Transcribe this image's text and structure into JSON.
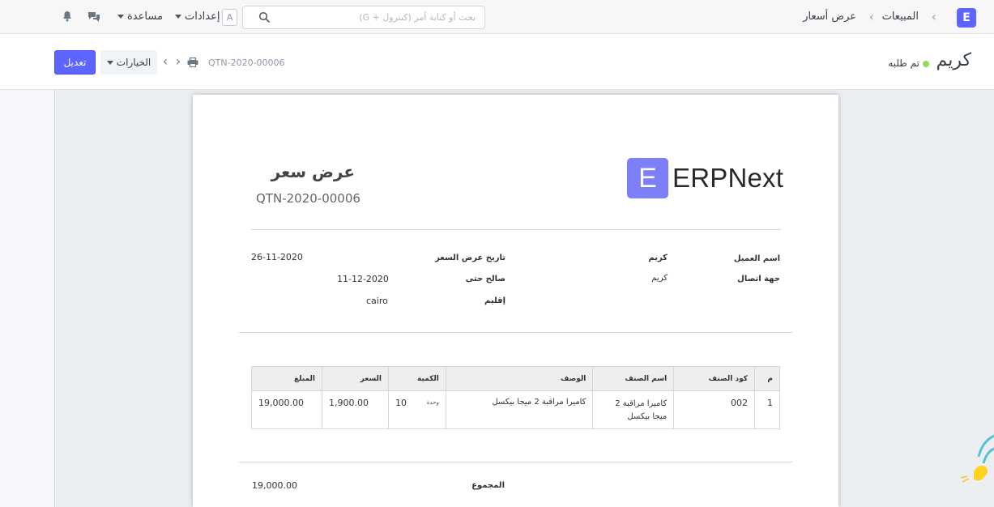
{
  "navbar": {
    "logo_letter": "E",
    "breadcrumbs": [
      "المبيعات",
      "عرض أسعار"
    ],
    "search_placeholder": "بحث أو كتابة أمر (كنترول + G)",
    "language_badge": "A",
    "settings_label": "إعدادات",
    "help_label": "مساعدة"
  },
  "page_head": {
    "title": "كريم",
    "status": "تم طلبه",
    "doc_id": "QTN-2020-00006",
    "options_label": "الخيارات",
    "edit_label": "تعديل"
  },
  "print": {
    "logo_letter": "E",
    "logo_text": "ERPNext",
    "heading": "عرض سعر",
    "doc_id": "QTN-2020-00006",
    "fields": {
      "customer_name_label": "اسم العميل",
      "customer_name": "كريم",
      "contact_label": "جهة اتصال",
      "contact": "كريم",
      "quotation_date_label": "تاريخ عرض السعر",
      "quotation_date": "26-11-2020",
      "valid_till_label": "صالح حتى",
      "valid_till": "11-12-2020",
      "territory_label": "إقليم",
      "territory": "cairo"
    },
    "items_table": {
      "headers": [
        "م",
        "كود الصنف",
        "اسم الصنف",
        "الوصف",
        "الكمية",
        "السعر",
        "المبلغ"
      ],
      "rows": [
        {
          "idx": "1",
          "item_code": "002",
          "item_name": "كاميرا مراقبة 2 ميجا بيكسل",
          "description": "كاميرا مراقبة 2 ميجا بيكسل",
          "qty": "10",
          "uom": "وحدة",
          "rate": "1,900.00",
          "amount": "19,000.00"
        }
      ]
    },
    "total_label": "المجموع",
    "total_value": "19,000.00"
  }
}
